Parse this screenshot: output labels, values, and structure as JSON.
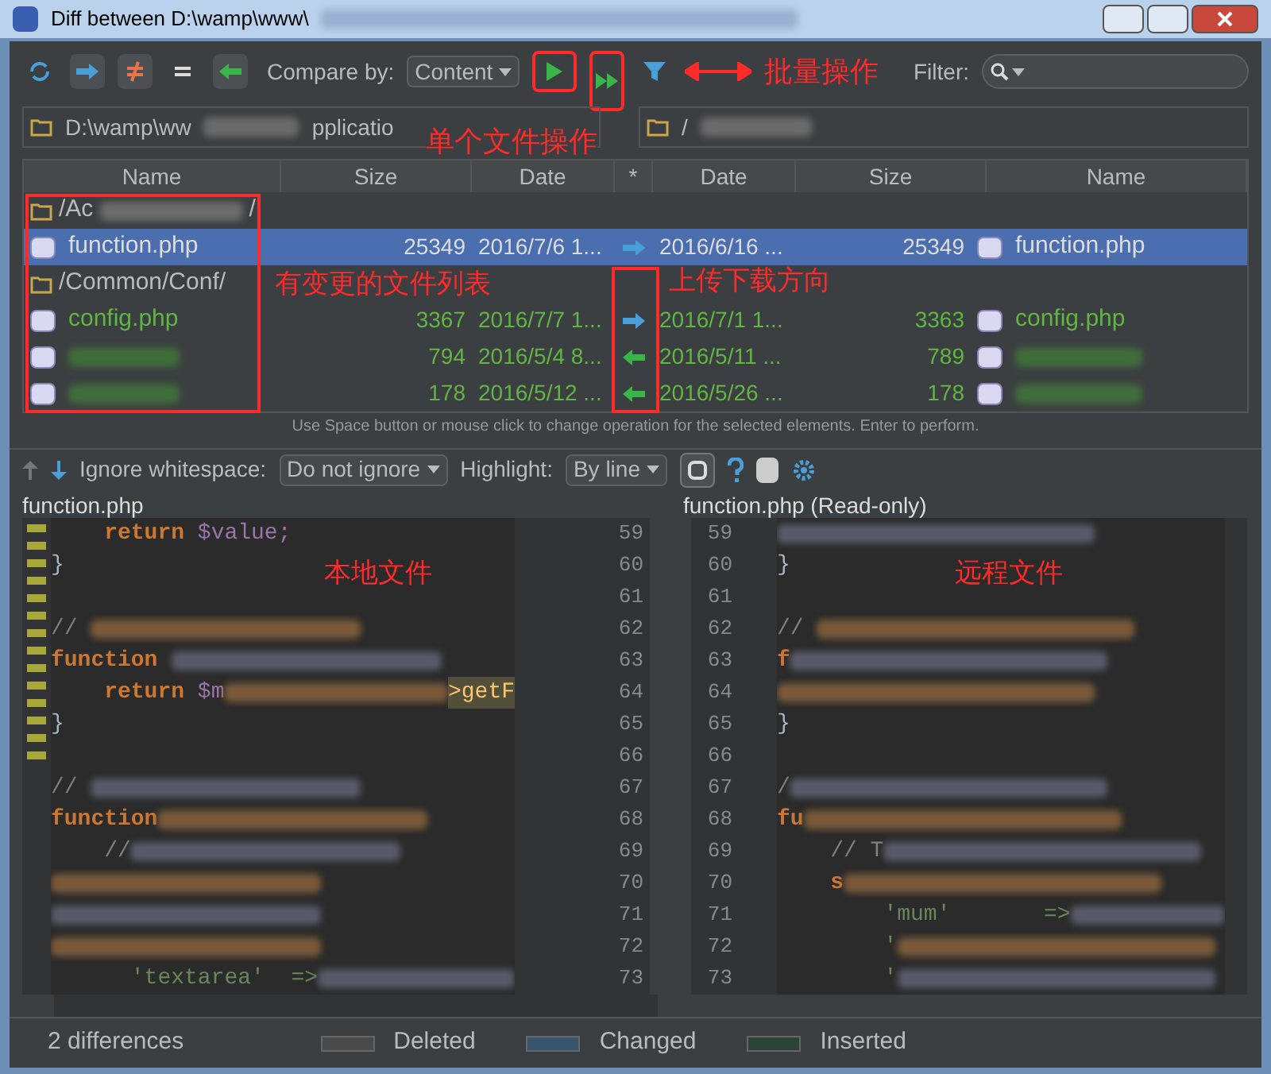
{
  "window": {
    "title": "Diff between D:\\wamp\\www\\"
  },
  "toolbar": {
    "compare_label": "Compare by:",
    "compare_value": "Content",
    "filter_label": "Filter:"
  },
  "paths": {
    "left": "D:\\wamp\\ww",
    "left_tail": "pplicatio",
    "right": "/"
  },
  "annotations": {
    "single": "单个文件操作",
    "batch": "批量操作",
    "list": "有变更的文件列表",
    "direction": "上传下载方向",
    "local": "本地文件",
    "remote": "远程文件"
  },
  "columns": [
    "Name",
    "Size",
    "Date",
    "*",
    "Date",
    "Size",
    "Name"
  ],
  "rows": [
    {
      "kind": "folder",
      "name": "/Ac",
      "tail": "/",
      "selected": false
    },
    {
      "kind": "file",
      "left_name": "function.php",
      "left_size": "25349",
      "left_date": "2016/7/6 1...",
      "upload": true,
      "right_date": "2016/6/16 ...",
      "right_size": "25349",
      "right_name": "function.php",
      "selected": true
    },
    {
      "kind": "folder",
      "name": "/Common/Conf/",
      "selected": false
    },
    {
      "kind": "file",
      "left_name": "config.php",
      "left_size": "3367",
      "left_date": "2016/7/7 1...",
      "upload": true,
      "right_date": "2016/7/1 1...",
      "right_size": "3363",
      "right_name": "config.php",
      "selected": false
    },
    {
      "kind": "file",
      "left_size": "794",
      "left_date": "2016/5/4 8...",
      "upload": false,
      "right_date": "2016/5/11 ...",
      "right_size": "789",
      "selected": false
    },
    {
      "kind": "file",
      "left_size": "178",
      "left_date": "2016/5/12 ...",
      "upload": false,
      "right_date": "2016/5/26 ...",
      "right_size": "178",
      "selected": false
    }
  ],
  "hint": "Use Space button or mouse click to change operation for the selected elements. Enter to perform.",
  "diff_toolbar": {
    "whitespace_label": "Ignore whitespace:",
    "whitespace_value": "Do not ignore",
    "highlight_label": "Highlight:",
    "highlight_value": "By line"
  },
  "left_title": "function.php",
  "right_title": "function.php (Read-only)",
  "left_lines": [
    {
      "num": "59",
      "segments": [
        {
          "text": "    return ",
          "kind": "keyword"
        },
        {
          "text": "$value;",
          "kind": "variable"
        }
      ]
    },
    {
      "num": "60",
      "segments": [
        {
          "text": "}",
          "kind": "plain"
        }
      ]
    },
    {
      "num": "61"
    },
    {
      "num": "62",
      "segments": [
        {
          "text": "// ",
          "kind": "comment"
        }
      ],
      "blurred": true
    },
    {
      "num": "63",
      "segments": [
        {
          "text": "function ",
          "kind": "keyword"
        }
      ],
      "blurred": true
    },
    {
      "num": "64",
      "segments": [
        {
          "text": "    return ",
          "kind": "keyword"
        },
        {
          "text": "$m",
          "kind": "variable"
        }
      ],
      "blurred": true,
      "after": ">getF"
    },
    {
      "num": "65",
      "segments": [
        {
          "text": "}",
          "kind": "plain"
        }
      ]
    },
    {
      "num": "66"
    },
    {
      "num": "67",
      "segments": [
        {
          "text": "// ",
          "kind": "comment"
        }
      ],
      "blurred": true
    },
    {
      "num": "68",
      "segments": [
        {
          "text": "function",
          "kind": "keyword"
        }
      ],
      "blurred": true
    },
    {
      "num": "69",
      "segments": [
        {
          "text": "    //",
          "kind": "comment"
        }
      ],
      "blurred": true
    },
    {
      "num": "70",
      "blurred": true
    },
    {
      "num": "71",
      "blurred": true
    },
    {
      "num": "72",
      "blurred": true
    },
    {
      "num": "73",
      "segments": [
        {
          "text": "      'textarea'  =>",
          "kind": "string"
        }
      ],
      "blurred": true
    }
  ],
  "right_lines": [
    {
      "num": "59",
      "blurred": true
    },
    {
      "num": "60",
      "segments": [
        {
          "text": "}",
          "kind": "plain"
        }
      ]
    },
    {
      "num": "61"
    },
    {
      "num": "62",
      "segments": [
        {
          "text": "// ",
          "kind": "comment"
        }
      ],
      "blurred": true
    },
    {
      "num": "63",
      "segments": [
        {
          "text": "f",
          "kind": "keyword"
        }
      ],
      "blurred": true
    },
    {
      "num": "64",
      "blurred": true
    },
    {
      "num": "65",
      "segments": [
        {
          "text": "}",
          "kind": "plain"
        }
      ]
    },
    {
      "num": "66"
    },
    {
      "num": "67",
      "segments": [
        {
          "text": "/",
          "kind": "comment"
        }
      ],
      "blurred": true
    },
    {
      "num": "68",
      "segments": [
        {
          "text": "fu",
          "kind": "keyword"
        }
      ],
      "blurred": true
    },
    {
      "num": "69",
      "segments": [
        {
          "text": "    // T",
          "kind": "comment"
        }
      ],
      "blurred": true
    },
    {
      "num": "70",
      "segments": [
        {
          "text": "    s",
          "kind": "keyword"
        }
      ],
      "blurred": true
    },
    {
      "num": "71",
      "segments": [
        {
          "text": "        'mum'       =>",
          "kind": "string"
        }
      ],
      "blurred": true
    },
    {
      "num": "72",
      "segments": [
        {
          "text": "        '",
          "kind": "string"
        }
      ],
      "blurred": true
    },
    {
      "num": "73",
      "segments": [
        {
          "text": "        '",
          "kind": "string"
        }
      ],
      "blurred": true
    }
  ],
  "status": "2 differences",
  "legend": [
    {
      "label": "Deleted",
      "color": "#4a4a4a"
    },
    {
      "label": "Changed",
      "color": "#385570"
    },
    {
      "label": "Inserted",
      "color": "#294436"
    }
  ]
}
